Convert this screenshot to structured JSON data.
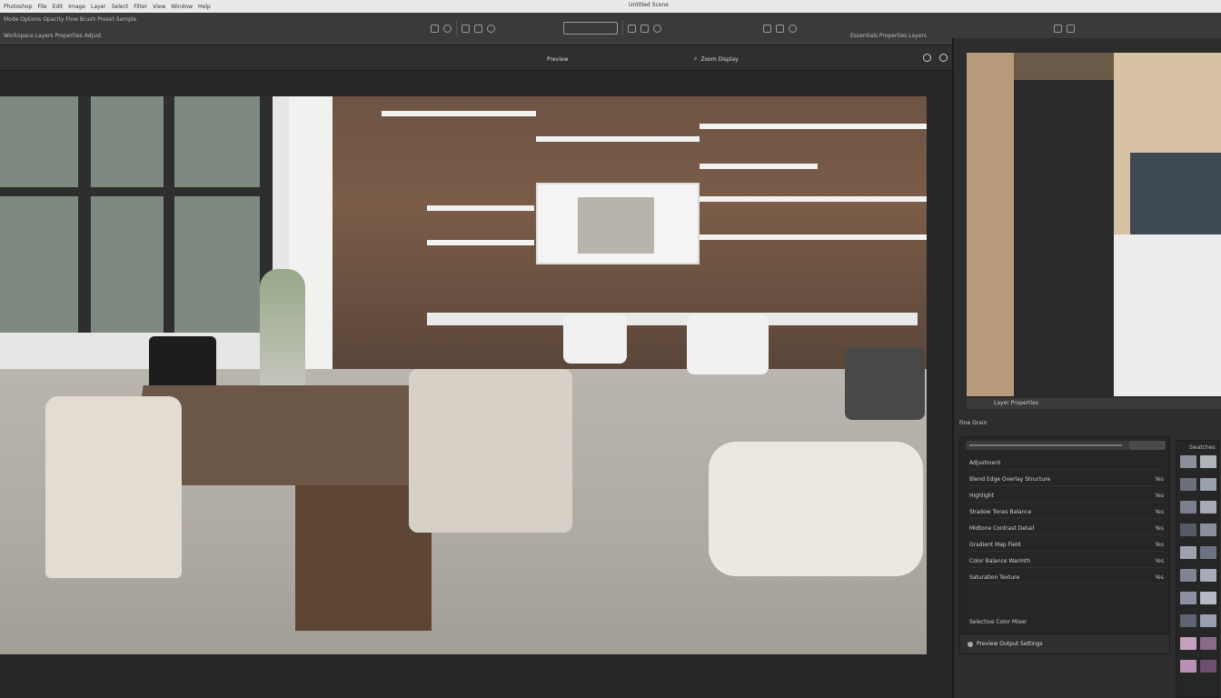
{
  "menubar": {
    "items": [
      "Photoshop",
      "File",
      "Edit",
      "Image",
      "Layer",
      "Select",
      "Filter",
      "View",
      "Window",
      "Help"
    ],
    "center_title": "Untitled Scene"
  },
  "toolbar": {
    "row1_text": "Mode Options  Opacity  Flow  Brush  Preset  Sample",
    "row2_text": "Workspace  Layers  Properties  Adjust",
    "right_text": "Essentials  Properties  Layers"
  },
  "document": {
    "tab_label": "Preview",
    "view_label": "Zoom Display",
    "colors": {
      "canvas_bg": "#262626",
      "panel_bg": "#2d2d2d"
    }
  },
  "right_panel": {
    "strip_label": "Layer Properties",
    "section_label": "Fine Grain",
    "rows": [
      {
        "label": "Adjustment",
        "value": ""
      },
      {
        "label": "Blend Edge Overlay Structure",
        "value": "Yes"
      },
      {
        "label": "Highlight",
        "value": "Yes"
      },
      {
        "label": "Shadow Tones Balance",
        "value": "Yes"
      },
      {
        "label": "Midtone Contrast Detail",
        "value": "Yes"
      },
      {
        "label": "Gradient Map Field",
        "value": "Yes"
      },
      {
        "label": "Color Balance Warmth",
        "value": "Yes"
      },
      {
        "label": "Saturation Texture",
        "value": "Yes"
      }
    ],
    "mid_label": "Selective Color Mixer",
    "footer_label": "Preview Output Settings",
    "swatch_header": "Swatches",
    "swatch_colors": [
      "#8a8f98",
      "#b0b3b8",
      "#6b707a",
      "#9aa1ad",
      "#7b8090",
      "#a7a9b5",
      "#545a66",
      "#8b8f9c",
      "#9da2ae",
      "#6c7280",
      "#7f8593",
      "#a8acb8",
      "#8c90a0",
      "#b6b8c4",
      "#5f6474",
      "#9a9fb0",
      "#c6a0c0",
      "#8a6a88",
      "#b98fb3",
      "#6d4e70"
    ]
  }
}
